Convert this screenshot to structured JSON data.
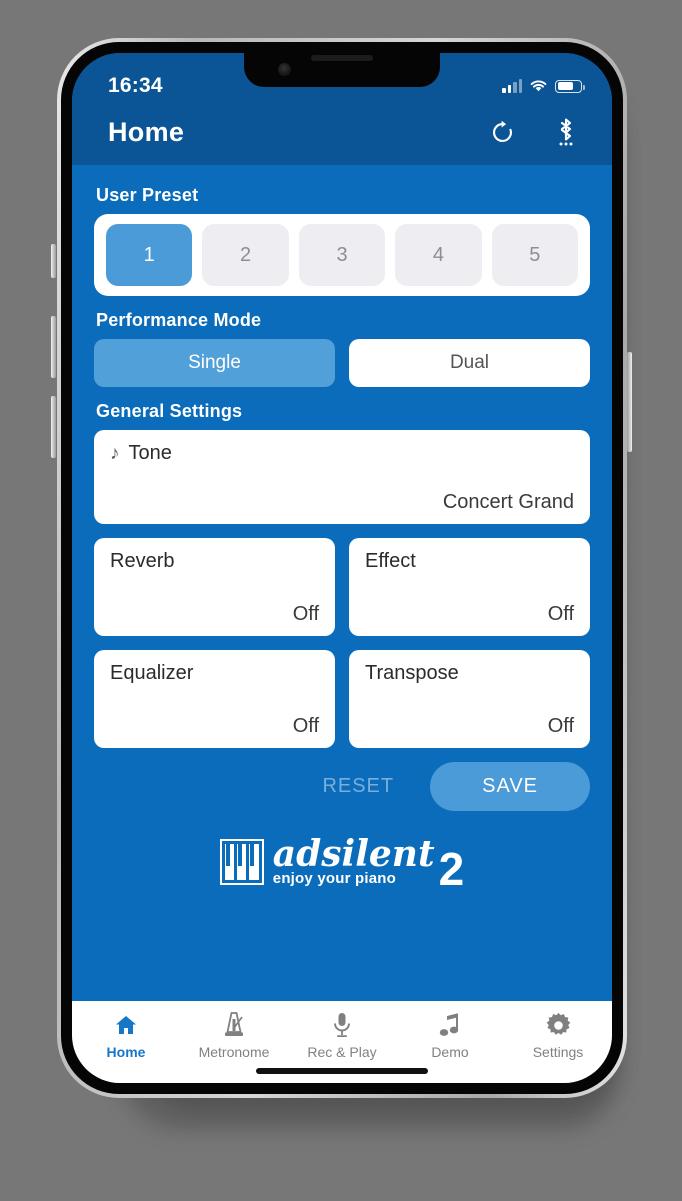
{
  "theme": {
    "brand_blue": "#0a6cba",
    "navbar_blue": "#0b5596",
    "accent_blue": "#4a9bd8",
    "tab_active": "#1676c8",
    "tab_inactive": "#808080"
  },
  "status_bar": {
    "time": "16:34",
    "signal_icon": "cellular-signal-icon",
    "wifi_icon": "wifi-icon",
    "battery_icon": "battery-icon"
  },
  "navbar": {
    "title": "Home",
    "refresh_icon": "refresh-icon",
    "bluetooth_icon": "bluetooth-icon"
  },
  "user_preset": {
    "label": "User Preset",
    "buttons": [
      {
        "label": "1",
        "active": true
      },
      {
        "label": "2",
        "active": false
      },
      {
        "label": "3",
        "active": false
      },
      {
        "label": "4",
        "active": false
      },
      {
        "label": "5",
        "active": false
      }
    ]
  },
  "performance_mode": {
    "label": "Performance Mode",
    "options": [
      {
        "label": "Single",
        "active": true
      },
      {
        "label": "Dual",
        "active": false
      }
    ]
  },
  "general_settings": {
    "label": "General Settings",
    "tone": {
      "title": "Tone",
      "value": "Concert Grand",
      "icon": "music-note-icon"
    },
    "cards": [
      {
        "title": "Reverb",
        "value": "Off"
      },
      {
        "title": "Effect",
        "value": "Off"
      },
      {
        "title": "Equalizer",
        "value": "Off"
      },
      {
        "title": "Transpose",
        "value": "Off"
      }
    ]
  },
  "actions": {
    "reset_label": "RESET",
    "save_label": "SAVE"
  },
  "logo": {
    "name": "adsilent",
    "tagline": "enjoy your piano",
    "version": "2",
    "keys_icon": "piano-keys-icon"
  },
  "tabbar": {
    "items": [
      {
        "label": "Home",
        "icon": "home-icon",
        "active": true
      },
      {
        "label": "Metronome",
        "icon": "metronome-icon",
        "active": false
      },
      {
        "label": "Rec & Play",
        "icon": "microphone-icon",
        "active": false
      },
      {
        "label": "Demo",
        "icon": "music-note-icon",
        "active": false
      },
      {
        "label": "Settings",
        "icon": "gear-icon",
        "active": false
      }
    ]
  }
}
